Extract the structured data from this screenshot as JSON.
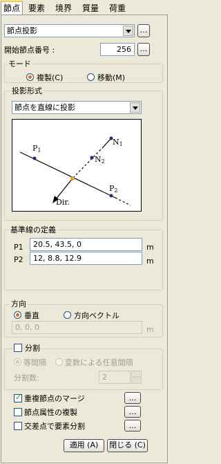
{
  "tabs": [
    "節点",
    "要素",
    "境界",
    "質量",
    "荷重"
  ],
  "operation": {
    "value": "節点投影",
    "more": "..."
  },
  "start_node": {
    "label": "開始節点番号  :",
    "value": "256",
    "more": "..."
  },
  "mode": {
    "title": "モード",
    "copy": "複製(C)",
    "move": "移動(M)",
    "selected": "copy"
  },
  "projection": {
    "title": "投影形式",
    "value": "節点を直線に投影",
    "diagram": {
      "p1": "P",
      "p1_sub": "1",
      "p2": "P",
      "p2_sub": "2",
      "n1": "N",
      "n1_sub": "1",
      "n2": "N",
      "n2_sub": "2",
      "dir": "Dir."
    }
  },
  "baseline": {
    "title": "基準線の定義",
    "p1_label": "P1",
    "p1_value": "20.5, 43.5, 0",
    "p1_unit": "m",
    "p2_label": "P2",
    "p2_value": "12, 8.8, 12.9",
    "p2_unit": "m"
  },
  "direction": {
    "title": "方向",
    "vertical": "垂直",
    "vector": "方向ベクトル",
    "selected": "vertical",
    "vector_value": "0, 0, 0",
    "unit": "m"
  },
  "divide": {
    "title": "分割",
    "checked": false,
    "equal": "等間隔",
    "variable": "変数による任意間隔",
    "count_label": "分割数:",
    "count_value": "2"
  },
  "options": [
    {
      "label": "重複節点のマージ",
      "checked": true,
      "more": "..."
    },
    {
      "label": "節点属性の複製",
      "checked": false,
      "more": "..."
    },
    {
      "label": "交差点で要素分割",
      "checked": false,
      "more": "..."
    }
  ],
  "buttons": {
    "apply": "適用 (A)",
    "close": "閉じる (C)"
  }
}
